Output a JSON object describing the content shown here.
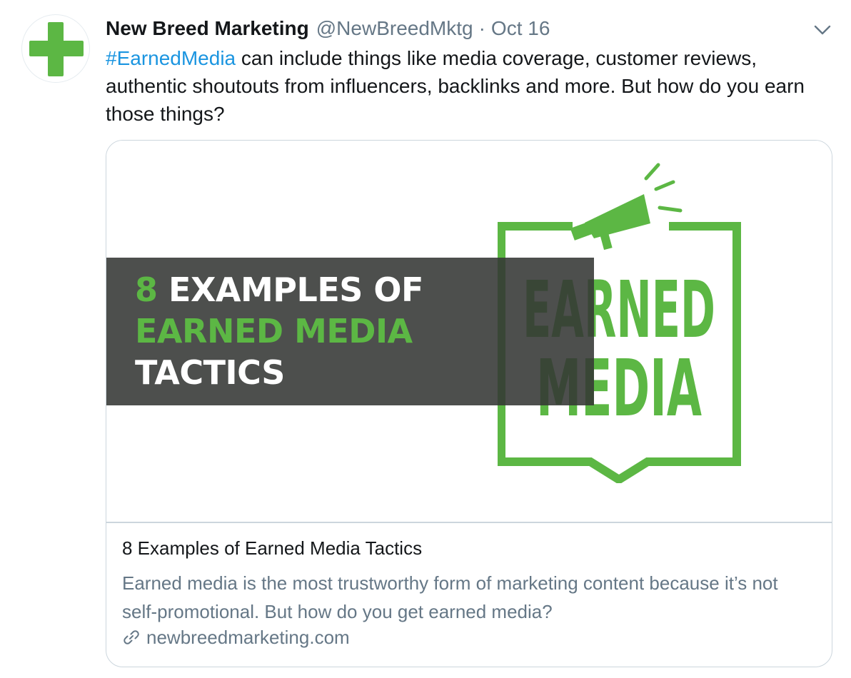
{
  "tweet": {
    "author_name": "New Breed Marketing",
    "handle": "@NewBreedMktg",
    "separator": "·",
    "date": "Oct 16",
    "hashtag": "#EarnedMedia",
    "text_rest": " can include things like media coverage, customer reviews, authentic shoutouts from influencers, backlinks and more. But how do you earn those things?"
  },
  "card": {
    "image": {
      "banner_number": "8",
      "banner_line1_rest": " EXAMPLES OF",
      "banner_line2": "EARNED MEDIA",
      "banner_line3": "TACTICS",
      "logo_word1": "EARNED",
      "logo_word2": "MEDIA"
    },
    "title": "8 Examples of Earned Media Tactics",
    "description": "Earned media is the most trustworthy form of marketing content because it’s not self-promotional. But how do you get earned media?",
    "domain": "newbreedmarketing.com"
  },
  "icons": {
    "avatar": "green-plus-logo-icon",
    "caret": "chevron-down-icon",
    "link": "link-icon"
  },
  "colors": {
    "brand_green": "#5cb744",
    "link_blue": "#1b95e0",
    "secondary_text": "#657786",
    "border": "#ccd6dd",
    "banner_overlay": "#343734"
  }
}
